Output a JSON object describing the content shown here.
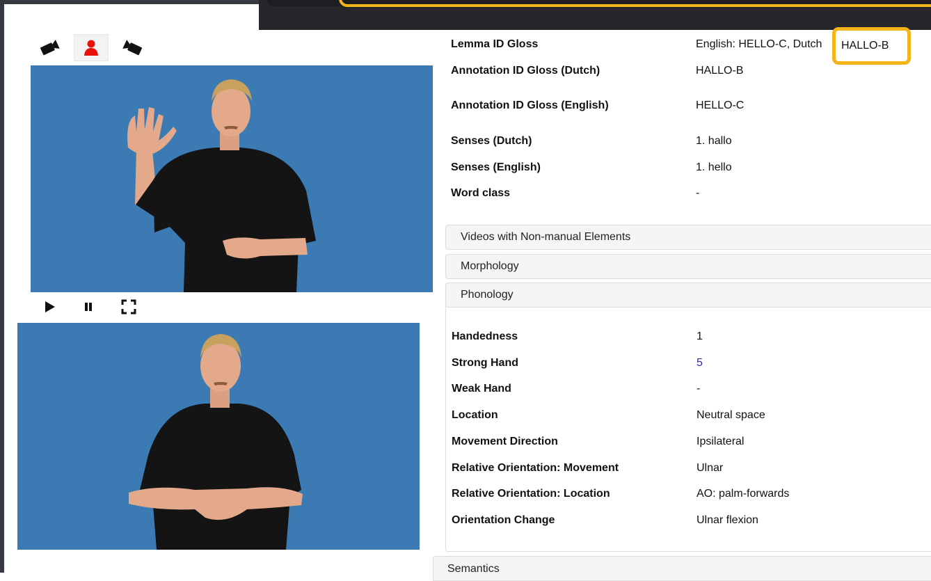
{
  "view_selector": {
    "buttons": [
      {
        "icon": "camera-left-icon"
      },
      {
        "icon": "person-icon",
        "active": true,
        "color": "#e8120c"
      },
      {
        "icon": "camera-right-icon"
      }
    ]
  },
  "video_controls": {
    "play": "play-icon",
    "pause": "pause-icon",
    "fullscreen": "fullscreen-icon"
  },
  "gloss": {
    "lemma_id_label": "Lemma ID Gloss",
    "lemma_id_value": "English: HELLO-C, Dutch",
    "lemma_id_dutch_value": "HALLO-B",
    "annotation_dutch_label": "Annotation ID Gloss (Dutch)",
    "annotation_dutch_value": "HALLO-B",
    "annotation_english_label": "Annotation ID Gloss (English)",
    "annotation_english_value": "HELLO-C",
    "senses_dutch_label": "Senses (Dutch)",
    "senses_dutch_value": "1. hallo",
    "senses_english_label": "Senses (English)",
    "senses_english_value": "1. hello",
    "word_class_label": "Word class",
    "word_class_value": "-"
  },
  "panels": {
    "nonmanual": "Videos with Non-manual Elements",
    "morphology": "Morphology",
    "phonology": "Phonology",
    "semantics": "Semantics"
  },
  "phonology": {
    "rows": [
      {
        "label": "Handedness",
        "value": "1"
      },
      {
        "label": "Strong Hand",
        "value": "5"
      },
      {
        "label": "Weak Hand",
        "value": "-"
      },
      {
        "label": "Location",
        "value": "Neutral space"
      },
      {
        "label": "Movement Direction",
        "value": "Ipsilateral"
      },
      {
        "label": "Relative Orientation: Movement",
        "value": "Ulnar"
      },
      {
        "label": "Relative Orientation: Location",
        "value": "AO: palm-forwards"
      },
      {
        "label": "Orientation Change",
        "value": "Ulnar flexion"
      }
    ]
  },
  "colors": {
    "highlight": "#f4b41a",
    "video_bg": "#3b7ab3",
    "link": "#2b2b9a"
  }
}
